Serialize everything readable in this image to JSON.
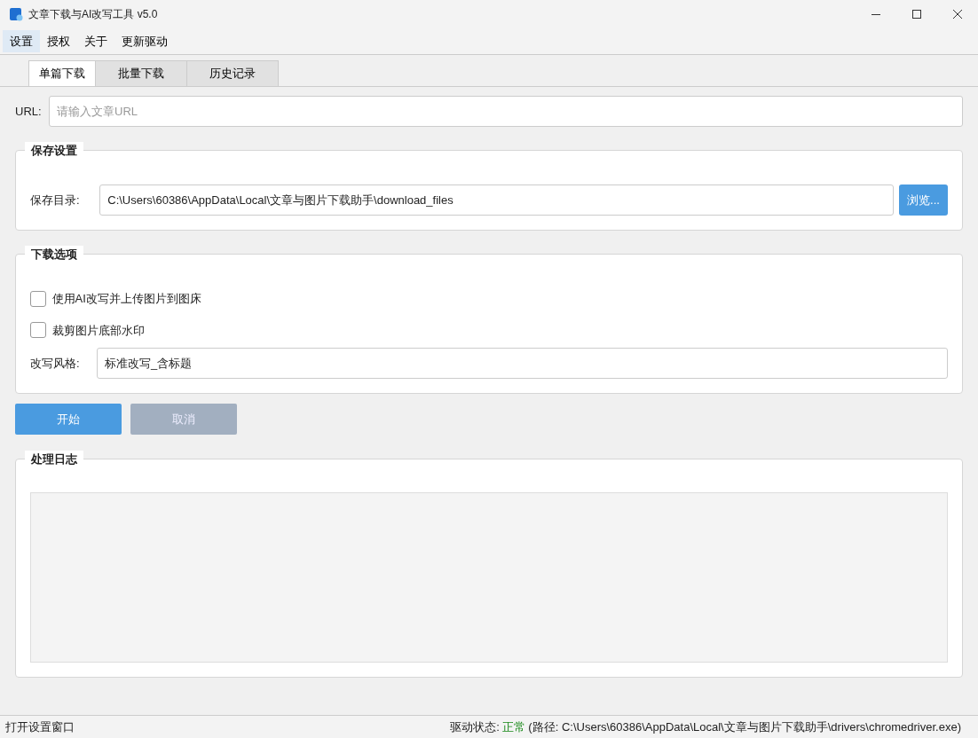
{
  "window": {
    "title": "文章下载与AI改写工具 v5.0"
  },
  "menu": [
    {
      "label": "设置",
      "selected": true
    },
    {
      "label": "授权",
      "selected": false
    },
    {
      "label": "关于",
      "selected": false
    },
    {
      "label": "更新驱动",
      "selected": false
    }
  ],
  "tabs": [
    {
      "label": "单篇下载",
      "selected": true
    },
    {
      "label": "批量下载",
      "selected": false
    },
    {
      "label": "历史记录",
      "selected": false
    }
  ],
  "url": {
    "label": "URL:",
    "placeholder": "请输入文章URL"
  },
  "save_settings": {
    "title": "保存设置",
    "dir_label": "保存目录:",
    "dir_value": "C:\\Users\\60386\\AppData\\Local\\文章与图片下载助手\\download_files",
    "browse_button": "浏览..."
  },
  "download_options": {
    "title": "下载选项",
    "checkboxes": [
      {
        "label": "使用AI改写并上传图片到图床",
        "checked": false
      },
      {
        "label": "裁剪图片底部水印",
        "checked": false
      }
    ],
    "style_label": "改写风格:",
    "style_value": "标准改写_含标题"
  },
  "buttons": [
    {
      "label": "开始",
      "disabled": false
    },
    {
      "label": "取消",
      "disabled": true
    }
  ],
  "log": {
    "title": "处理日志"
  },
  "status_bar": {
    "message": "打开设置窗口",
    "driver_label": "驱动状态:",
    "driver_state": {
      "text": "正常",
      "ok": true
    },
    "driver_path": "(路径: C:\\Users\\60386\\AppData\\Local\\文章与图片下载助手\\drivers\\chromedriver.exe)"
  }
}
